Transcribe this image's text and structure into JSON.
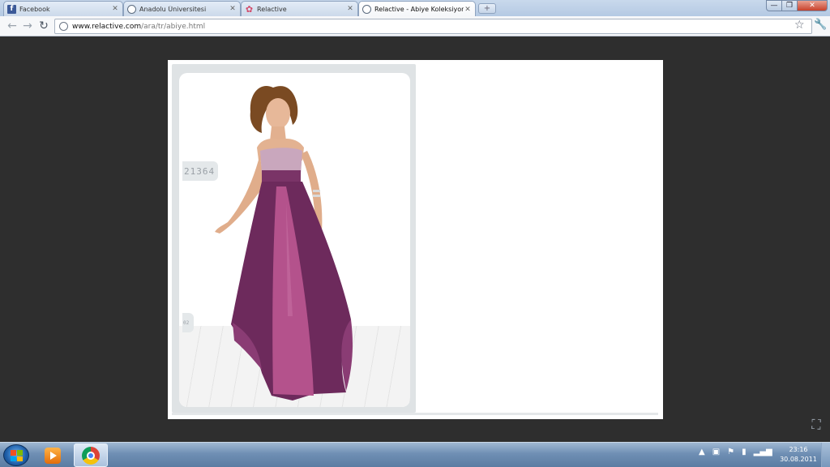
{
  "browser": {
    "tabs": [
      {
        "title": "Facebook",
        "icon": "facebook-icon",
        "active": false
      },
      {
        "title": "Anadolu Üniversitesi",
        "icon": "globe-icon",
        "active": false
      },
      {
        "title": "Relactive",
        "icon": "relactive-logo-icon",
        "active": false
      },
      {
        "title": "Relactive - Abiye Koleksiyonu",
        "icon": "globe-icon",
        "active": true
      }
    ],
    "new_tab_label": "+",
    "address": {
      "host": "www.relactive.com",
      "path": "/ara/tr/abiye.html"
    },
    "window_controls": {
      "minimize": "—",
      "maximize": "❐",
      "close": "✕"
    }
  },
  "page": {
    "product_code": "21364",
    "page_number": "02",
    "colors": {
      "dress_dark": "#6d2a5c",
      "dress_light": "#b4528c",
      "bodice": "#c9a7bd"
    }
  },
  "taskbar": {
    "clock_time": "23:16",
    "clock_date": "30.08.2011",
    "tray_arrow": "▲"
  }
}
